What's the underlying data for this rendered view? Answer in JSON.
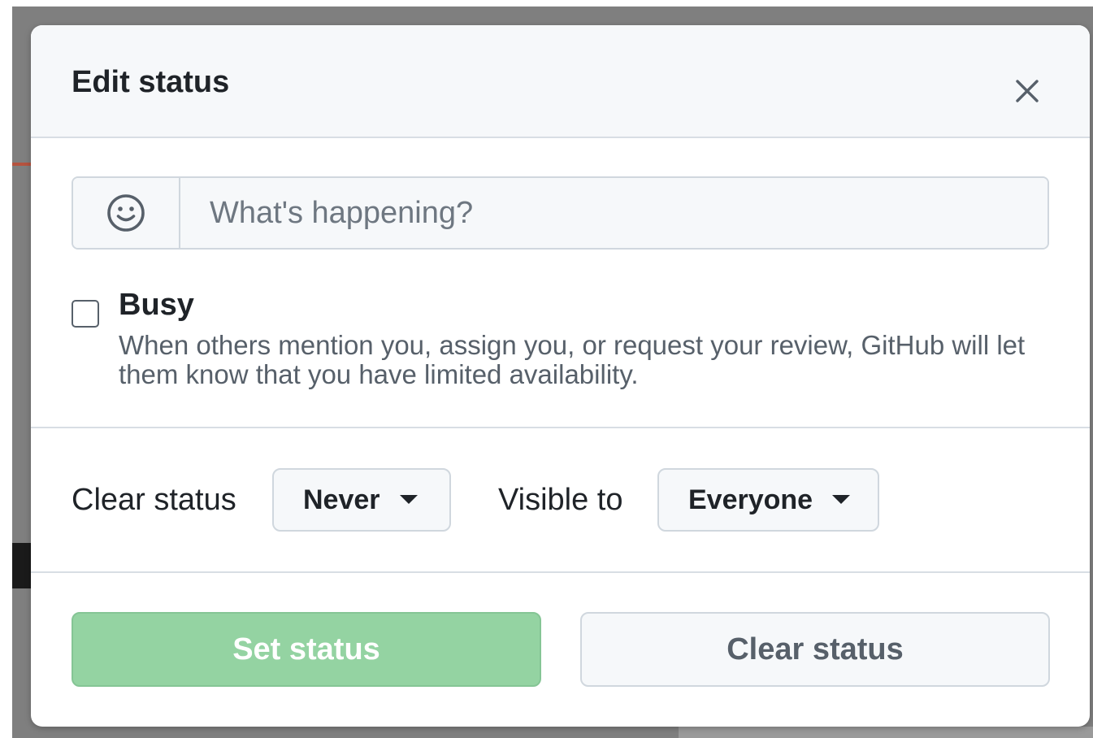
{
  "dialog": {
    "title": "Edit status",
    "close_icon": "close-icon"
  },
  "status_input": {
    "emoji_icon": "smiley-icon",
    "placeholder": "What's happening?",
    "value": ""
  },
  "busy": {
    "label": "Busy",
    "checked": false,
    "description": "When others mention you, assign you, or request your review, GitHub will let them know that you have limited availability."
  },
  "options": {
    "clear_status_label": "Clear status",
    "clear_status_value": "Never",
    "visible_to_label": "Visible to",
    "visible_to_value": "Everyone",
    "caret_icon": "triangle-down-icon"
  },
  "actions": {
    "set_status_label": "Set status",
    "clear_status_label": "Clear status"
  },
  "colors": {
    "primary_button_disabled": "#94d3a2",
    "header_background": "#f6f8fa",
    "border": "#d0d7de"
  }
}
